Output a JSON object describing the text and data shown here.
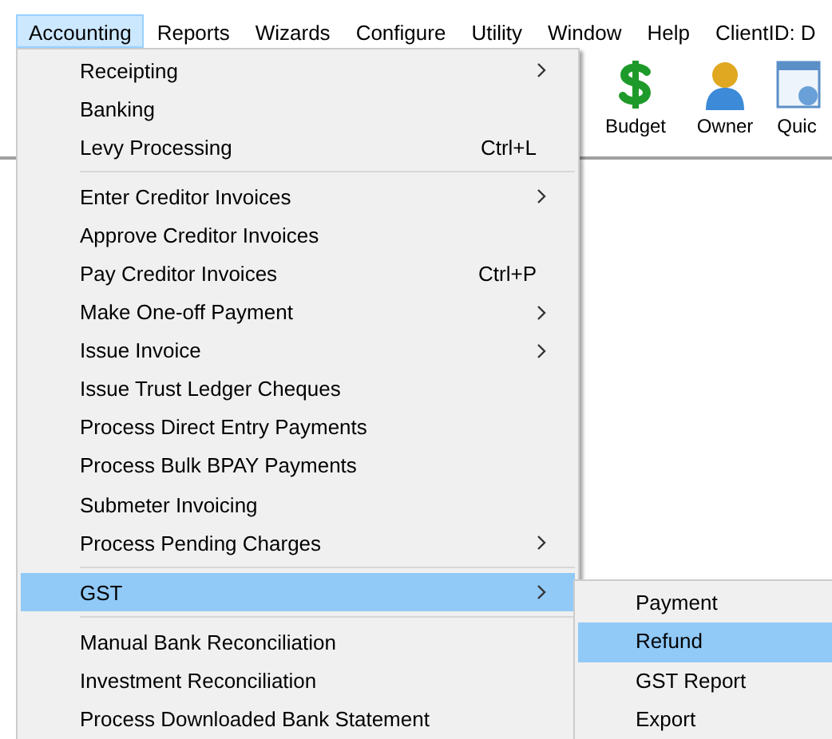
{
  "menubar": [
    {
      "label": "Accounting",
      "selected": true
    },
    {
      "label": "Reports",
      "selected": false
    },
    {
      "label": "Wizards",
      "selected": false
    },
    {
      "label": "Configure",
      "selected": false
    },
    {
      "label": "Utility",
      "selected": false
    },
    {
      "label": "Window",
      "selected": false
    },
    {
      "label": "Help",
      "selected": false
    },
    {
      "label": "ClientID: D",
      "selected": false
    }
  ],
  "toolbar": [
    {
      "label": "Budget",
      "kind": "dollar"
    },
    {
      "label": "Owner",
      "kind": "person"
    },
    {
      "label": "Quic",
      "kind": "calendar"
    }
  ],
  "menu": [
    {
      "kind": "item",
      "label": "Receipting",
      "submenu": true,
      "selected": false
    },
    {
      "kind": "item",
      "label": "Banking",
      "submenu": false,
      "selected": false
    },
    {
      "kind": "item",
      "label": "Levy Processing",
      "shortcut": "Ctrl+L",
      "submenu": false,
      "selected": false
    },
    {
      "kind": "separator"
    },
    {
      "kind": "item",
      "label": "Enter Creditor Invoices",
      "submenu": true,
      "selected": false
    },
    {
      "kind": "item",
      "label": "Approve Creditor Invoices",
      "submenu": false,
      "selected": false
    },
    {
      "kind": "item",
      "label": "Pay Creditor Invoices",
      "shortcut": "Ctrl+P",
      "submenu": false,
      "selected": false
    },
    {
      "kind": "item",
      "label": "Make One-off Payment",
      "submenu": true,
      "selected": false
    },
    {
      "kind": "item",
      "label": "Issue Invoice",
      "submenu": true,
      "selected": false
    },
    {
      "kind": "item",
      "label": "Issue Trust Ledger Cheques",
      "submenu": false,
      "selected": false
    },
    {
      "kind": "item",
      "label": "Process Direct Entry Payments",
      "submenu": false,
      "selected": false
    },
    {
      "kind": "item",
      "label": "Process Bulk BPAY Payments",
      "submenu": false,
      "selected": false
    },
    {
      "kind": "item",
      "label": "Submeter Invoicing",
      "submenu": false,
      "selected": false
    },
    {
      "kind": "item",
      "label": "Process Pending Charges",
      "submenu": true,
      "selected": false
    },
    {
      "kind": "separator"
    },
    {
      "kind": "item",
      "label": "GST",
      "submenu": true,
      "selected": true
    },
    {
      "kind": "separator"
    },
    {
      "kind": "item",
      "label": "Manual Bank Reconciliation",
      "submenu": false,
      "selected": false
    },
    {
      "kind": "item",
      "label": "Investment Reconciliation",
      "submenu": false,
      "selected": false
    },
    {
      "kind": "item",
      "label": "Process Downloaded Bank Statement",
      "submenu": false,
      "selected": false
    }
  ],
  "submenu": [
    {
      "label": "Payment",
      "selected": false
    },
    {
      "label": "Refund",
      "selected": true
    },
    {
      "label": "GST Report",
      "selected": false
    },
    {
      "label": "Export",
      "selected": false
    }
  ]
}
